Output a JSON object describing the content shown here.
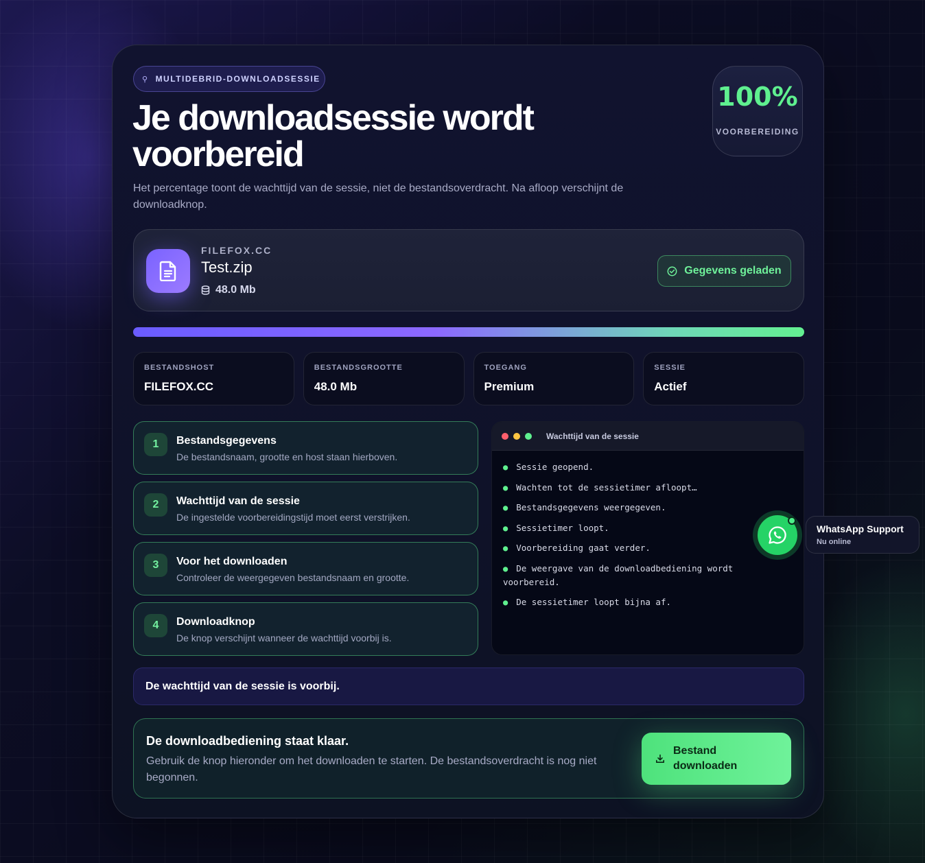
{
  "header": {
    "badge": "MULTIDEBRID-DOWNLOADSESSIE",
    "title": "Je downloadsessie wordt voorbereid",
    "subtitle": "Het percentage toont de wachttijd van de sessie, niet de bestandsoverdracht. Na afloop verschijnt de downloadknop.",
    "percent": "100%",
    "percent_label": "VOORBEREIDING",
    "progress_fraction": 1.0
  },
  "file": {
    "host": "FILEFOX.CC",
    "name": "Test.zip",
    "size": "48.0 Mb",
    "status_label": "Gegevens geladen"
  },
  "stats": [
    {
      "label": "BESTANDSHOST",
      "value": "FILEFOX.CC"
    },
    {
      "label": "BESTANDSGROOTTE",
      "value": "48.0 Mb"
    },
    {
      "label": "TOEGANG",
      "value": "Premium"
    },
    {
      "label": "SESSIE",
      "value": "Actief"
    }
  ],
  "steps": [
    {
      "num": "1",
      "title": "Bestandsgegevens",
      "desc": "De bestandsnaam, grootte en host staan hierboven."
    },
    {
      "num": "2",
      "title": "Wachttijd van de sessie",
      "desc": "De ingestelde voorbereidingstijd moet eerst verstrijken."
    },
    {
      "num": "3",
      "title": "Voor het downloaden",
      "desc": "Controleer de weergegeven bestandsnaam en grootte."
    },
    {
      "num": "4",
      "title": "Downloadknop",
      "desc": "De knop verschijnt wanneer de wachttijd voorbij is."
    }
  ],
  "terminal": {
    "title": "Wachttijd van de sessie",
    "lines": [
      "Sessie geopend.",
      "Wachten tot de sessietimer afloopt…",
      "Bestandsgegevens weergegeven.",
      "Sessietimer loopt.",
      "Voorbereiding gaat verder.",
      "De weergave van de downloadbediening wordt voorbereid.",
      "De sessietimer loopt bijna af."
    ]
  },
  "done_message": "De wachttijd van de sessie is voorbij.",
  "ready": {
    "title": "De downloadbediening staat klaar.",
    "desc": "Gebruik de knop hieronder om het downloaden te starten. De bestandsoverdracht is nog niet begonnen.",
    "button_label": "Bestand downloaden"
  },
  "support": {
    "title": "WhatsApp Support",
    "status": "Nu online"
  },
  "colors": {
    "accent_green": "#5ff08f",
    "accent_purple": "#7a63ff",
    "whatsapp": "#25d366"
  },
  "icons": {
    "badge": "rocket-icon",
    "file": "document-icon",
    "size": "database-icon",
    "status": "check-circle-icon",
    "download": "download-icon",
    "support": "whatsapp-icon"
  }
}
